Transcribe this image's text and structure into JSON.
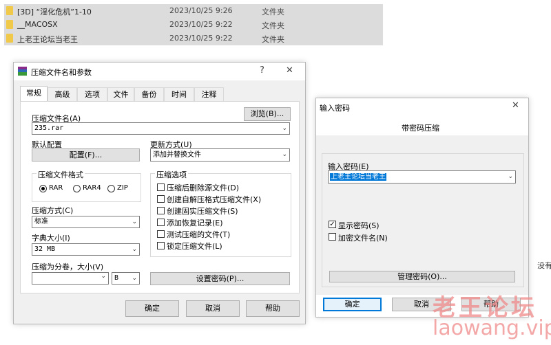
{
  "file_list": [
    {
      "name": "[3D] “淫化危机”1-10",
      "date": "2023/10/25 9:26",
      "type": "文件夹"
    },
    {
      "name": "__MACOSX",
      "date": "2023/10/25 9:22",
      "type": "文件夹"
    },
    {
      "name": "上老王论坛当老王",
      "date": "2023/10/25 9:22",
      "type": "文件夹"
    }
  ],
  "archive_dialog": {
    "title": "压缩文件名和参数",
    "help_glyph": "?",
    "close_glyph": "✕",
    "tabs": [
      "常规",
      "高级",
      "选项",
      "文件",
      "备份",
      "时间",
      "注释"
    ],
    "active_tab": "常规",
    "archive_name_label": "压缩文件名(A)",
    "browse_button": "浏览(B)...",
    "archive_name_value": "235.rar",
    "default_profile_label": "默认配置",
    "profile_button": "配置(F)...",
    "update_mode_label": "更新方式(U)",
    "update_mode_value": "添加并替换文件",
    "format_group_title": "压缩文件格式",
    "formats": [
      {
        "label": "RAR",
        "selected": true
      },
      {
        "label": "RAR4",
        "selected": false
      },
      {
        "label": "ZIP",
        "selected": false
      }
    ],
    "options_group_title": "压缩选项",
    "options": [
      {
        "label": "压缩后删除源文件(D)",
        "checked": false
      },
      {
        "label": "创建自解压格式压缩文件(X)",
        "checked": false
      },
      {
        "label": "创建固实压缩文件(S)",
        "checked": false
      },
      {
        "label": "添加恢复记录(E)",
        "checked": false
      },
      {
        "label": "测试压缩的文件(T)",
        "checked": false
      },
      {
        "label": "锁定压缩文件(L)",
        "checked": false
      }
    ],
    "method_label": "压缩方式(C)",
    "method_value": "标准",
    "dict_label": "字典大小(I)",
    "dict_value": "32 MB",
    "split_label": "压缩为分卷，大小(V)",
    "split_unit": "B",
    "set_password_button": "设置密码(P)...",
    "ok_button": "确定",
    "cancel_button": "取消",
    "help_button": "帮助"
  },
  "password_dialog": {
    "title": "输入密码",
    "close_glyph": "✕",
    "heading": "带密码压缩",
    "password_label": "输入密码(E)",
    "password_value": "上老王论坛当老王",
    "show_password_label": "显示密码(S)",
    "show_password_checked": true,
    "encrypt_names_label": "加密文件名(N)",
    "encrypt_names_checked": false,
    "manage_button": "管理密码(O)...",
    "ok_button": "确定",
    "cancel_button": "取消",
    "help_button": "帮助"
  },
  "right_edge_text": "没有",
  "watermark": {
    "cn": "老王论坛",
    "url": "laowang.vip"
  },
  "colors": {
    "accent": "#0078d7",
    "folder": "#f1c94a",
    "watermark": "#f08a8a"
  }
}
